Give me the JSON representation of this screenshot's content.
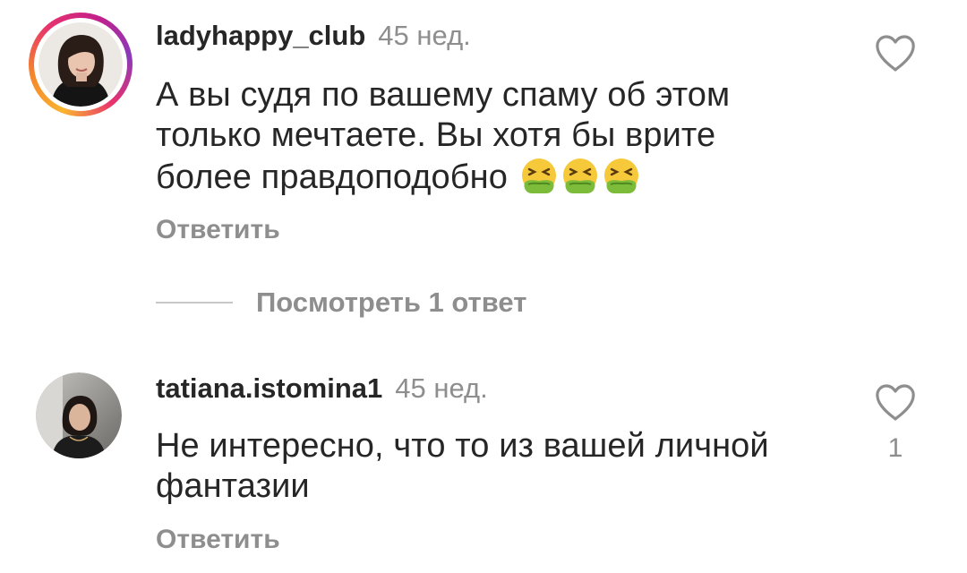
{
  "comments": [
    {
      "username": "ladyhappy_club",
      "time": "45 нед.",
      "text": "А вы судя по вашему спаму об этом только мечтаете. Вы хотя бы врите более правдоподобно",
      "emojis": [
        "nauseated-face",
        "nauseated-face",
        "nauseated-face"
      ],
      "reply_label": "Ответить",
      "has_story_ring": true,
      "view_replies_label": "Посмотреть 1 ответ",
      "like_count": ""
    },
    {
      "username": "tatiana.istomina1",
      "time": "45 нед.",
      "text": "Не интересно, что то из вашей личной фантазии",
      "reply_label": "Ответить",
      "has_story_ring": false,
      "like_count": "1"
    }
  ],
  "colors": {
    "text_primary": "#262626",
    "text_secondary": "#8e8e8e",
    "divider": "#c7c7c7",
    "ring_start": "#f9b430",
    "ring_end": "#c3208a"
  }
}
